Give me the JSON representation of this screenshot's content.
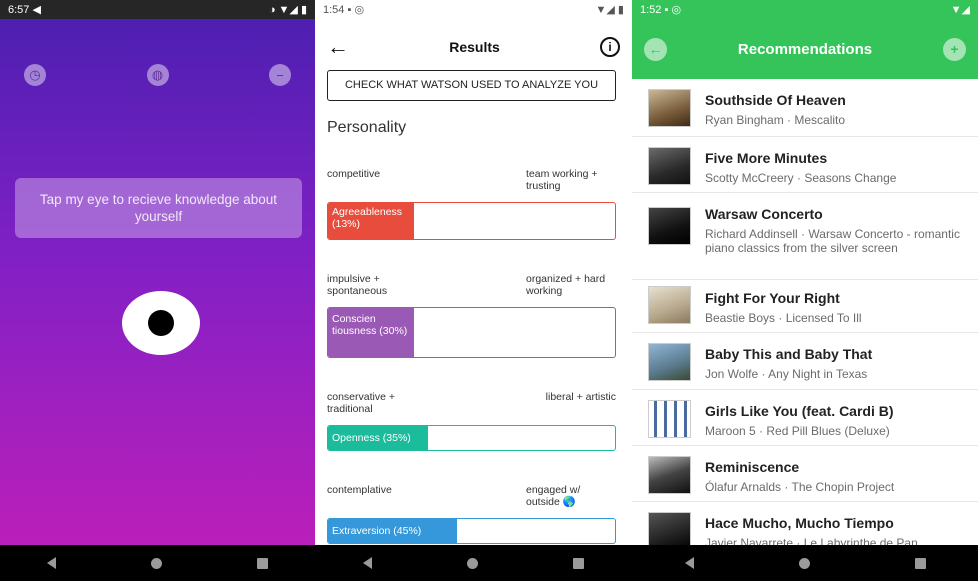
{
  "screen1": {
    "status_time": "6:57",
    "status_icons": "◑ ▼◢ ▮",
    "tap_text": "Tap my eye to recieve knowledge about yourself",
    "icons": [
      "clock-icon",
      "globe-icon",
      "minus-circle-icon"
    ]
  },
  "screen2": {
    "status_time": "1:54",
    "status_icons": "▼◢ ▮",
    "title": "Results",
    "watson_button": "CHECK WHAT WATSON USED TO ANALYZE YOU",
    "section": "Personality",
    "traits": [
      {
        "left": "competitive",
        "right": "team working + trusting",
        "label": "Agreeableness (13%)",
        "value": 13,
        "color": "#e74c3c"
      },
      {
        "left": "impulsive + spontaneous",
        "right": "organized + hard working",
        "label": "Conscien tiousness (30%)",
        "value": 30,
        "color": "#9b59b6"
      },
      {
        "left": "conservative + traditional",
        "right": "liberal + artistic",
        "label": "Openness (35%)",
        "value": 35,
        "color": "#1abc9c"
      },
      {
        "left": "contemplative",
        "right": "engaged w/ outside 🌎",
        "label": "Extraversion (45%)",
        "value": 45,
        "color": "#3498db"
      }
    ]
  },
  "screen3": {
    "status_time": "1:52",
    "status_icons": "▼◢",
    "title": "Recommendations",
    "accent": "#35c45a",
    "songs": [
      {
        "title": "Southside Of Heaven",
        "sub": "Ryan Bingham · Mescalito"
      },
      {
        "title": "Five More Minutes",
        "sub": "Scotty McCreery · Seasons Change"
      },
      {
        "title": "Warsaw Concerto",
        "sub": "Richard Addinsell · Warsaw Concerto - romantic piano classics from the silver screen"
      },
      {
        "title": "Fight For Your Right",
        "sub": "Beastie Boys · Licensed To Ill"
      },
      {
        "title": "Baby This and Baby That",
        "sub": "Jon Wolfe · Any Night in Texas"
      },
      {
        "title": "Girls Like You (feat. Cardi B)",
        "sub": "Maroon 5 · Red Pill Blues (Deluxe)"
      },
      {
        "title": "Reminiscence",
        "sub": "Ólafur Arnalds · The Chopin Project"
      },
      {
        "title": "Hace Mucho, Mucho Tiempo",
        "sub": "Javier Navarrete · Le Labyrinthe de Pan"
      }
    ]
  }
}
